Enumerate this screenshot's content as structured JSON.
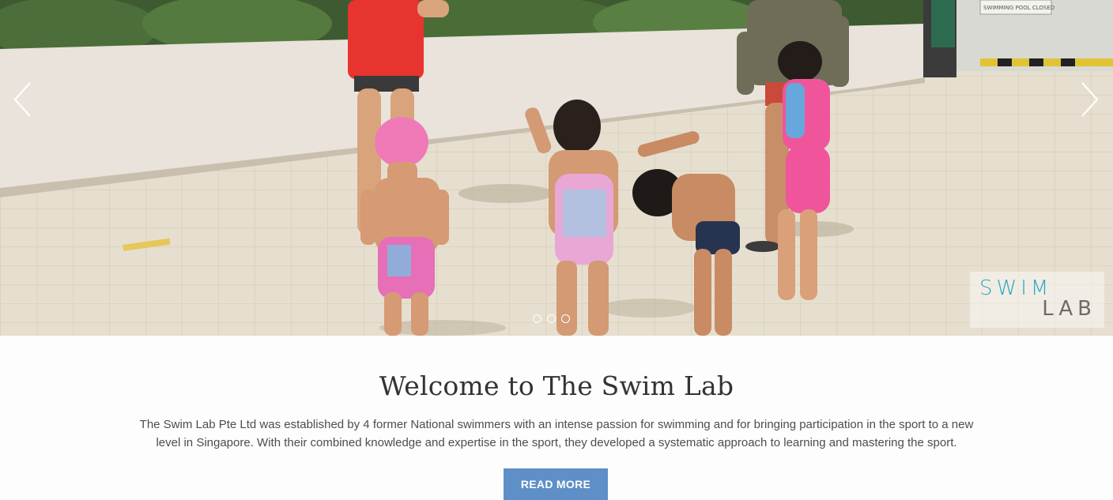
{
  "slider": {
    "prev_icon": "chevron-left-icon",
    "next_icon": "chevron-right-icon",
    "dots_count": 3,
    "active_dot": 1,
    "sign_text": "SWIMMING POOL CLOSED",
    "logo": {
      "line1": "SWIM",
      "line2": "LAB"
    }
  },
  "welcome": {
    "title": "Welcome to The Swim Lab",
    "paragraph": "The Swim Lab Pte Ltd was established by 4 former National swimmers with an intense passion for swimming and for bringing participation in the sport to a new level in Singapore. With their combined knowledge and expertise in the sport, they developed a systematic approach to learning and mastering the sport.",
    "button_label": "READ MORE"
  },
  "colors": {
    "accent_button": "#5e8fc6",
    "logo_blue": "#2aa8c4",
    "logo_gray": "#6c6c6c"
  }
}
